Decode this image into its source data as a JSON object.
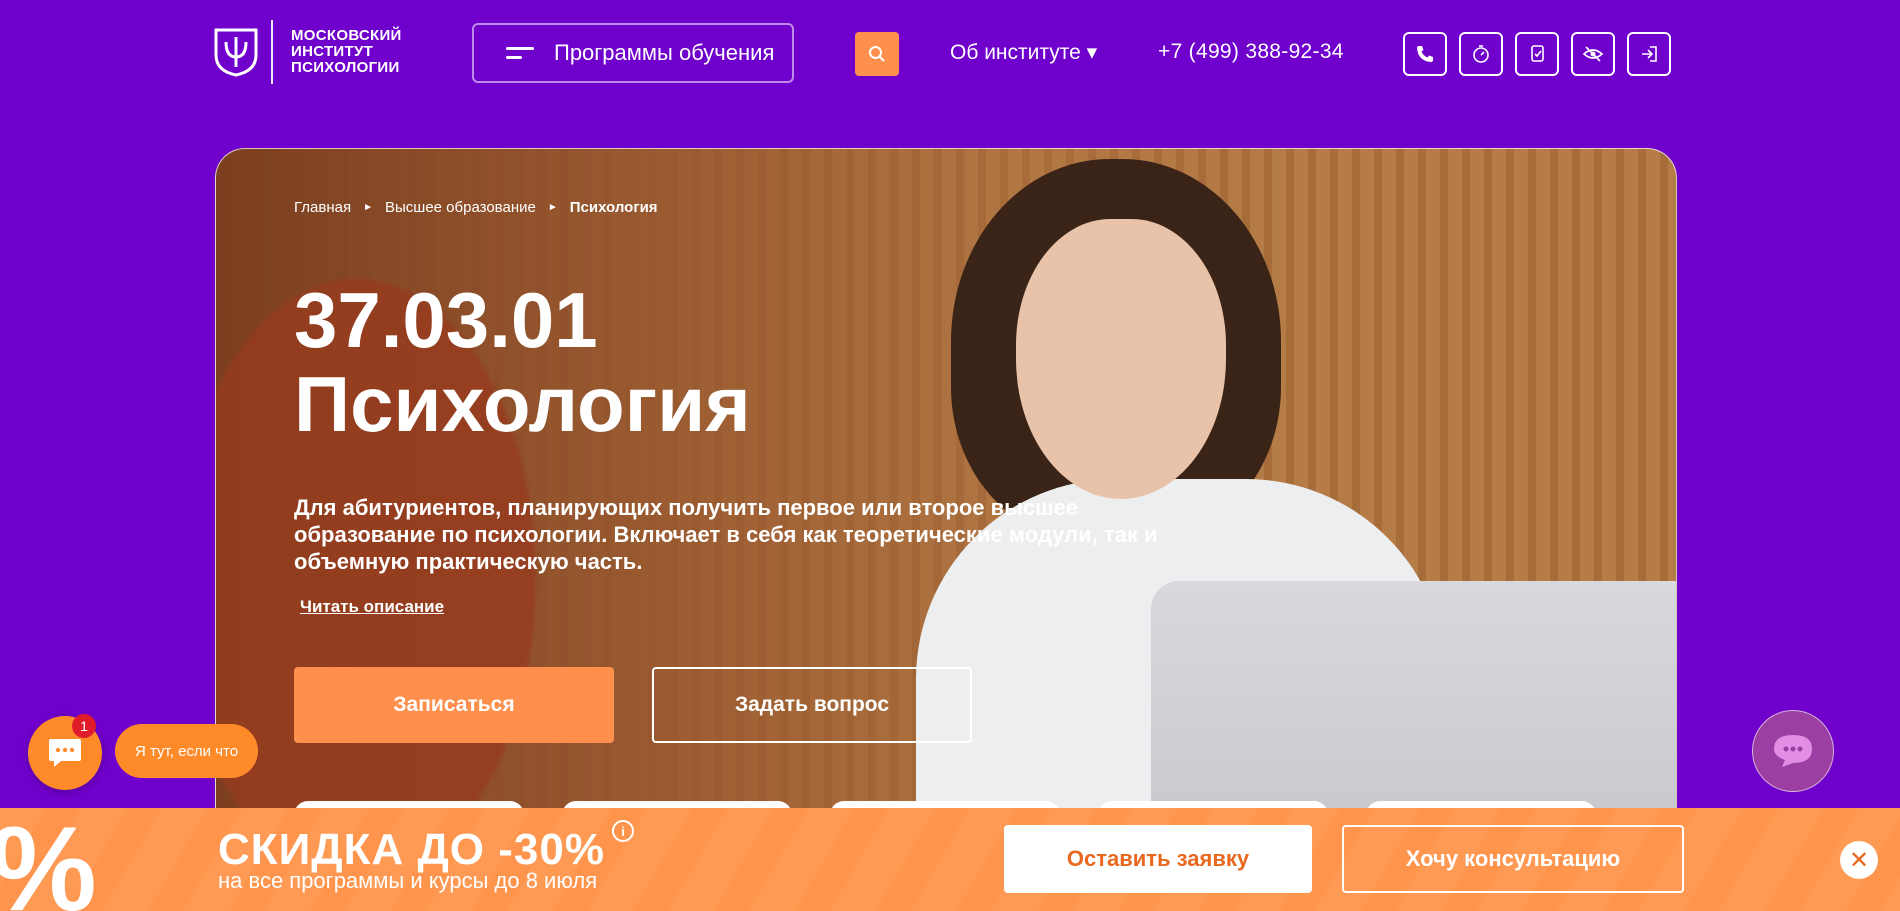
{
  "header": {
    "logo_line1": "МОСКОВСКИЙ",
    "logo_line2": "ИНСТИТУТ",
    "logo_line3": "ПСИХОЛОГИИ",
    "programs_label": "Программы обучения",
    "about_label": "Об институте ▾",
    "phone": "+7 (499) 388-92-34",
    "icons": [
      "phone-icon",
      "timer-icon",
      "document-check-icon",
      "eye-slash-icon",
      "login-icon"
    ]
  },
  "hero": {
    "breadcrumb": [
      "Главная",
      "Высшее образование",
      "Психология"
    ],
    "code": "37.03.01",
    "title": "Психология",
    "description": "Для абитуриентов, планирующих получить первое или второе высшее образование по психологии. Включает в себя как теоретические модули, так и объемную практическую часть.",
    "read_more": "Читать описание",
    "primary_button": "Записаться",
    "secondary_button": "Задать вопрос"
  },
  "chat": {
    "badge_count": "1",
    "bubble_text": "Я тут, если что"
  },
  "promo": {
    "title": "СКИДКА ДО -30%",
    "info": "i",
    "subtitle": "на все программы и курсы до 8 июля",
    "button1": "Оставить заявку",
    "button2": "Хочу консультацию",
    "close": "✕"
  },
  "colors": {
    "brand_purple": "#7000cc",
    "accent_orange": "#ff8f4d"
  }
}
